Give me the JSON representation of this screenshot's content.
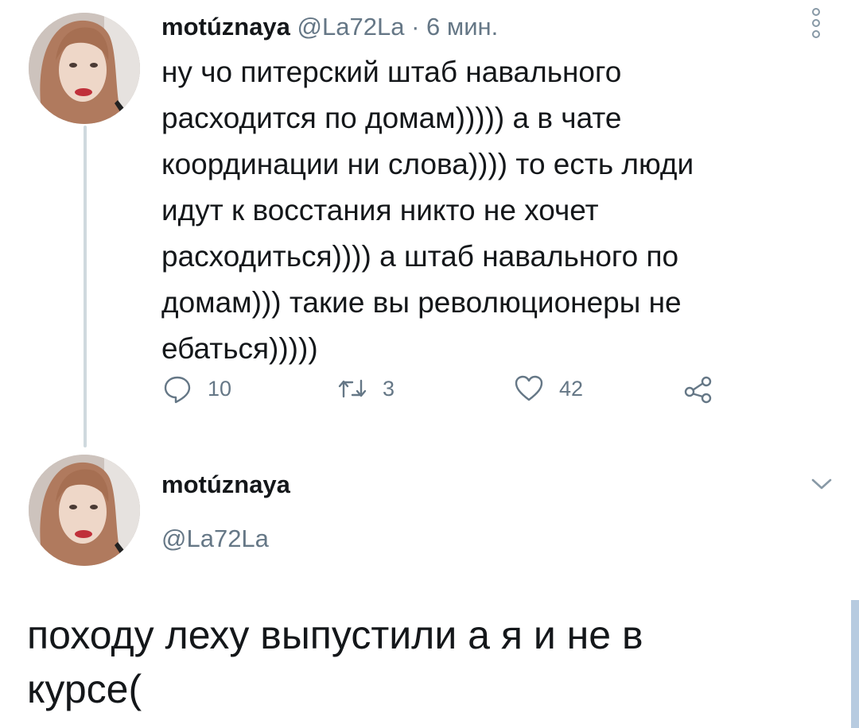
{
  "tweet1": {
    "display_name": "motúznaya",
    "handle": "@La72La",
    "separator": "·",
    "time": "6 мин.",
    "text": "ну чо питерский штаб навального\nрасходится по домам))))) а в чате\nкоординации ни слова)))) то есть люди\nидут к восстания никто не хочет\nрасходиться)))) а штаб навального по\nдомам))) такие вы революционеры не\nебаться)))))",
    "actions": {
      "reply_count": "10",
      "retweet_count": "3",
      "like_count": "42"
    }
  },
  "tweet2": {
    "display_name": "motúznaya",
    "handle": "@La72La",
    "text": "походу леху выпустили а я и не в\nкурсе("
  },
  "icons": {
    "reply": "reply-icon",
    "retweet": "retweet-icon",
    "like": "heart-icon",
    "share": "share-icon",
    "more": "more-vertical-icon",
    "menu": "chevron-down-icon"
  },
  "colors": {
    "text": "#14171a",
    "secondary": "#657786",
    "thread_line": "#cfd9de",
    "scrollbar": "#b7cbe0"
  }
}
